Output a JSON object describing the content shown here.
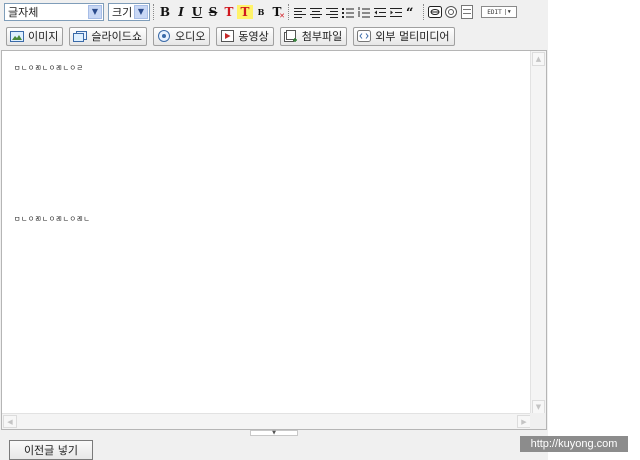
{
  "toolbar": {
    "font_select": "글자체",
    "size_select": "크기",
    "format_buttons": {
      "bold": "B",
      "italic": "I",
      "underline": "U",
      "strike": "S",
      "text_color": "T",
      "bg_color": "T",
      "small_b": "B",
      "clear_format": "T"
    },
    "edit_button": "EDIT"
  },
  "media": {
    "image": "이미지",
    "slideshow": "슬라이드쇼",
    "audio": "오디오",
    "video": "동영상",
    "attachment": "첨부파일",
    "external": "외부 멀티미디어"
  },
  "content": {
    "line1": "ㅁㄴㅇㄻㄴㅇㄻㄴㅇㄹ",
    "line2": "ㅁㄴㅇㄻㄴㅇㄻㄴㅇㄻㄴ"
  },
  "bottom_button": "이전글 넣기",
  "watermark": "http://kuyong.com",
  "colors": {
    "toolbar_bg": "#f0f0f0",
    "accent_red": "#d0181f",
    "highlight": "#fff36a"
  }
}
